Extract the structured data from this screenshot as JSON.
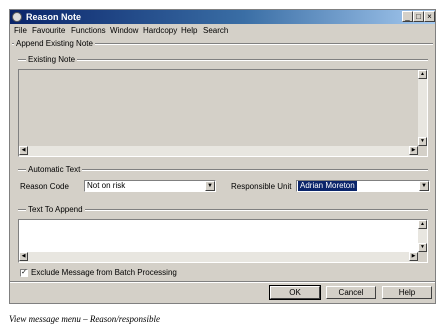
{
  "window": {
    "title": "Reason Note",
    "minimize": "_",
    "maximize": "□",
    "close": "×"
  },
  "menu": [
    "File",
    "Favourite",
    "Functions",
    "Window",
    "Hardcopy",
    "Help",
    "Search"
  ],
  "append_existing_note": {
    "label": "Append Existing Note",
    "existing_note_label": "Existing Note"
  },
  "automatic_text": {
    "label": "Automatic Text",
    "reason_code_label": "Reason Code",
    "reason_code_value": "Not on risk",
    "responsible_unit_label": "Responsible Unit",
    "responsible_unit_value": "Adrian Moreton"
  },
  "text_to_append": {
    "label": "Text To Append"
  },
  "exclude_checkbox": {
    "label": "Exclude Message from Batch Processing",
    "checked": true,
    "mark": "✓"
  },
  "buttons": {
    "ok": "OK",
    "cancel": "Cancel",
    "help": "Help"
  },
  "caption": "View message menu – Reason/responsible"
}
